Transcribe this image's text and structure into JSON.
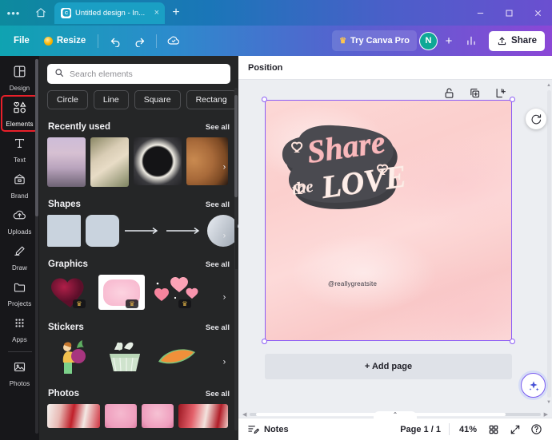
{
  "window": {
    "tab_title": "Untitled design - In...",
    "close_glyph": "×",
    "newtab_glyph": "+",
    "minimize_glyph": "–",
    "maximize_glyph": "□",
    "close_window_glyph": "×",
    "menu_glyph": "•••"
  },
  "toolbar": {
    "file_label": "File",
    "resize_label": "Resize",
    "try_pro_label": "Try Canva Pro",
    "crown_glyph": "♛",
    "avatar_initial": "N",
    "plus_glyph": "+",
    "share_label": "Share"
  },
  "rail": {
    "items": [
      {
        "label": "Design",
        "icon": "design-icon"
      },
      {
        "label": "Elements",
        "icon": "elements-icon"
      },
      {
        "label": "Text",
        "icon": "text-icon"
      },
      {
        "label": "Brand",
        "icon": "brand-icon"
      },
      {
        "label": "Uploads",
        "icon": "uploads-icon"
      },
      {
        "label": "Draw",
        "icon": "draw-icon"
      },
      {
        "label": "Projects",
        "icon": "projects-icon"
      },
      {
        "label": "Apps",
        "icon": "apps-icon"
      },
      {
        "label": "Photos",
        "icon": "photos-icon"
      }
    ]
  },
  "panel": {
    "search_placeholder": "Search elements",
    "search_value": "",
    "chips": [
      "Circle",
      "Line",
      "Square",
      "Rectangle"
    ],
    "chip_truncated": "Rectang",
    "see_all_label": "See all",
    "next_glyph": "›",
    "sections": [
      {
        "title": "Recently used",
        "see_all": "See all"
      },
      {
        "title": "Shapes",
        "see_all": "See all"
      },
      {
        "title": "Graphics",
        "see_all": "See all"
      },
      {
        "title": "Stickers",
        "see_all": "See all"
      },
      {
        "title": "Photos",
        "see_all": "See all"
      }
    ]
  },
  "editor": {
    "position_label": "Position",
    "add_page_label": "+ Add page",
    "object_tools": [
      "unlock-icon",
      "duplicate-icon",
      "add-page-icon"
    ],
    "design": {
      "headline_line1": "Share",
      "headline_line2_small": "the",
      "headline_line2_big": "LOVE",
      "handle_text": "@reallygreatsite"
    }
  },
  "bottombar": {
    "notes_label": "Notes",
    "page_label": "Page 1 / 1",
    "zoom_label": "41%",
    "grid_icon": "grid-view-icon",
    "expand_icon": "fullscreen-icon",
    "help_icon": "help-icon",
    "chevron_glyph": "⌃"
  },
  "colors": {
    "accent_purple": "#8b5cf6",
    "highlight_red": "#e8202a",
    "panel_bg": "#252627",
    "rail_bg": "#17171a",
    "canvas_bg": "#eceef2",
    "avatar_teal": "#0fa896"
  }
}
